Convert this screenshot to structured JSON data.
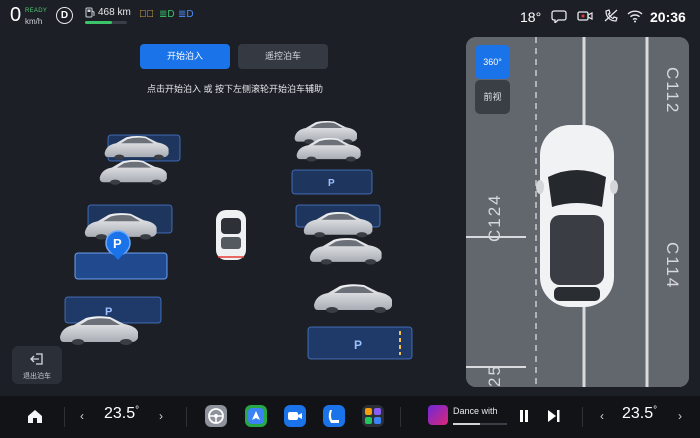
{
  "status_bar": {
    "speed": "0",
    "ready": "READY",
    "speed_unit": "km/h",
    "gear": "D",
    "range": "468 km",
    "range_fraction": 0.65,
    "lamps": [
      "fuel-icon",
      "fog-lamp-icon",
      "low-beam-icon",
      "auto-headlight-icon"
    ],
    "outside_temp": "18°",
    "icons": [
      "message-icon",
      "camera-record-icon",
      "phone-off-icon",
      "wifi-icon"
    ],
    "time": "20:36",
    "colors": {
      "ready": "#50c878",
      "range_fill": "#3cc46a"
    }
  },
  "parking": {
    "start_button": "开始泊入",
    "remote_button": "遥控泊车",
    "hint": "点击开始泊入 或 按下左侧滚轮开始泊车辅助",
    "slot_label": "P",
    "exit_button": "退出泊车",
    "accent": "#1a73e8"
  },
  "camera": {
    "view_360": "360°",
    "view_front": "前视",
    "bay_labels": [
      "C112",
      "C124",
      "C114",
      "25"
    ]
  },
  "dock": {
    "left_temp": "23.5",
    "right_temp": "23.5",
    "degree": "°",
    "apps": [
      "steering-wheel-icon",
      "navigation-icon",
      "video-call-icon",
      "seat-icon",
      "app-grid-icon"
    ],
    "song": "Dance with",
    "song_progress": 0.5
  }
}
